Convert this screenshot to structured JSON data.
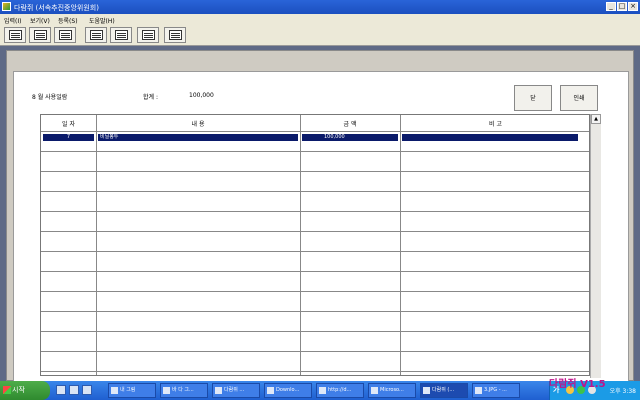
{
  "window": {
    "title": "다람쥐 (서속추진중앙위원회)",
    "buttons": [
      "_",
      "□",
      "×"
    ]
  },
  "menu": [
    "입력(I)",
    "보기(V)",
    "등록(S)",
    "도움말(H)"
  ],
  "toolbar": {
    "icons": [
      "edit-icon",
      "book-icon",
      "stamp-icon",
      "chart-icon",
      "pen-icon",
      "card-icon",
      "calc-icon"
    ]
  },
  "report": {
    "heading": "8 월 사용일람",
    "total_label": "합계 :",
    "total_value": "100,000",
    "btn_close": "닫",
    "btn_print": "인쇄"
  },
  "table": {
    "columns": [
      "일 자",
      "내 용",
      "금 액",
      "비 고"
    ],
    "rows": [
      {
        "day": "7",
        "content": "비닐봉투",
        "amount": "100,000",
        "note": ""
      }
    ],
    "empty_rows": 12
  },
  "taskbar": {
    "start_label": "시작",
    "tasks": [
      {
        "label": "내 그림",
        "icon": "folder-icon"
      },
      {
        "label": "바 다 그...",
        "icon": "ie-icon"
      },
      {
        "label": "다람쥐 ...",
        "icon": "window-icon"
      },
      {
        "label": "Downlo...",
        "icon": "folder-icon"
      },
      {
        "label": "http://d...",
        "icon": "ie-icon"
      },
      {
        "label": "Microso...",
        "icon": "word-icon"
      },
      {
        "label": "다람쥐 (...",
        "icon": "squirrel-icon",
        "active": true
      },
      {
        "label": "3.JPG - ...",
        "icon": "paint-icon"
      }
    ],
    "ime": "가",
    "clock": "오후 3:38"
  },
  "brand": "다람쥐 V1.5",
  "colors": {
    "title": "#1b4fbf",
    "selection": "#0a1a6a",
    "brand": "#c0138a"
  }
}
